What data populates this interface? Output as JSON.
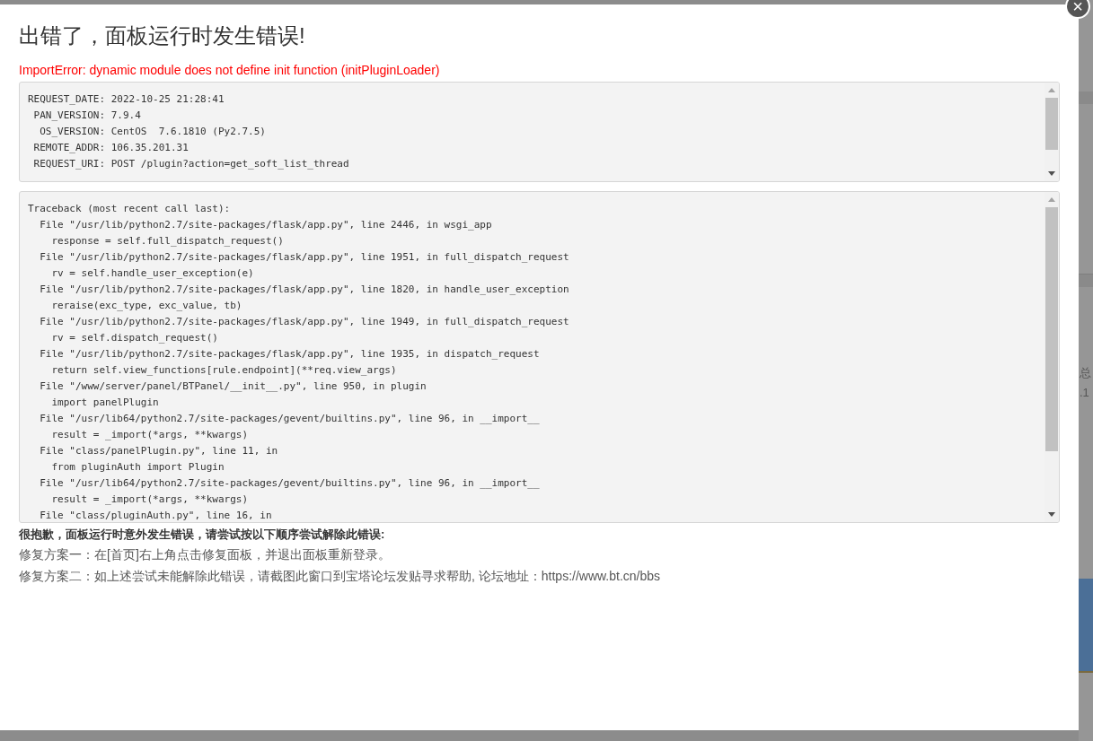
{
  "background": {
    "labels": [
      "总",
      ".1"
    ]
  },
  "dialog": {
    "close": "×",
    "title": "出错了，面板运行时发生错误!",
    "error": "ImportError: dynamic module does not define init function (initPluginLoader)",
    "request_info": [
      "REQUEST_DATE: 2022-10-25 21:28:41",
      " PAN_VERSION: 7.9.4",
      "  OS_VERSION: CentOS  7.6.1810 (Py2.7.5)",
      " REMOTE_ADDR: 106.35.201.31",
      " REQUEST_URI: POST /plugin?action=get_soft_list_thread"
    ],
    "traceback": [
      "Traceback (most recent call last):",
      "  File \"/usr/lib/python2.7/site-packages/flask/app.py\", line 2446, in wsgi_app",
      "    response = self.full_dispatch_request()",
      "  File \"/usr/lib/python2.7/site-packages/flask/app.py\", line 1951, in full_dispatch_request",
      "    rv = self.handle_user_exception(e)",
      "  File \"/usr/lib/python2.7/site-packages/flask/app.py\", line 1820, in handle_user_exception",
      "    reraise(exc_type, exc_value, tb)",
      "  File \"/usr/lib/python2.7/site-packages/flask/app.py\", line 1949, in full_dispatch_request",
      "    rv = self.dispatch_request()",
      "  File \"/usr/lib/python2.7/site-packages/flask/app.py\", line 1935, in dispatch_request",
      "    return self.view_functions[rule.endpoint](**req.view_args)",
      "  File \"/www/server/panel/BTPanel/__init__.py\", line 950, in plugin",
      "    import panelPlugin",
      "  File \"/usr/lib64/python2.7/site-packages/gevent/builtins.py\", line 96, in __import__",
      "    result = _import(*args, **kwargs)",
      "  File \"class/panelPlugin.py\", line 11, in",
      "    from pluginAuth import Plugin",
      "  File \"/usr/lib64/python2.7/site-packages/gevent/builtins.py\", line 96, in __import__",
      "    result = _import(*args, **kwargs)",
      "  File \"class/pluginAuth.py\", line 16, in"
    ],
    "help_heading": "很抱歉，面板运行时意外发生错误，请尝试按以下顺序尝试解除此错误:",
    "fixes": [
      "修复方案一：在[首页]右上角点击修复面板，并退出面板重新登录。",
      "修复方案二：如上述尝试未能解除此错误，请截图此窗口到宝塔论坛发贴寻求帮助, 论坛地址：https://www.bt.cn/bbs"
    ]
  }
}
